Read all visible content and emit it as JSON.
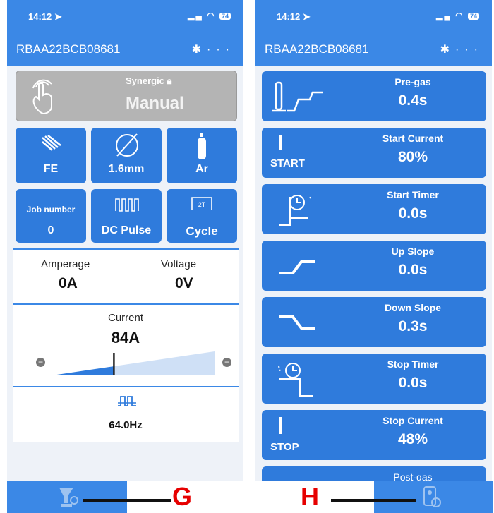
{
  "left": {
    "time": "14:12",
    "battery": "74",
    "device_id": "RBAA22BCB08681",
    "mode_top": "Synergic",
    "mode_main": "Manual",
    "material": "FE",
    "diameter": "1.6mm",
    "gas": "Ar",
    "job_label": "Job number",
    "job_value": "0",
    "process": "DC Pulse",
    "cycle_badge": "2T",
    "cycle": "Cycle",
    "amperage_label": "Amperage",
    "amperage_value": "0A",
    "voltage_label": "Voltage",
    "voltage_value": "0V",
    "current_label": "Current",
    "current_value": "84A",
    "current_fraction": 0.38,
    "frequency_value": "64.0Hz"
  },
  "right": {
    "time": "14:12",
    "battery": "74",
    "device_id": "RBAA22BCB08681",
    "params": [
      {
        "name": "Pre-gas",
        "value": "0.4s"
      },
      {
        "name": "Start Current",
        "value": "80%",
        "tag": "START"
      },
      {
        "name": "Start Timer",
        "value": "0.0s"
      },
      {
        "name": "Up Slope",
        "value": "0.0s"
      },
      {
        "name": "Down Slope",
        "value": "0.3s"
      },
      {
        "name": "Stop Timer",
        "value": "0.0s"
      },
      {
        "name": "Stop Current",
        "value": "48%",
        "tag": "STOP"
      },
      {
        "name": "Post-gas"
      }
    ]
  },
  "annotations": {
    "left_letter": "G",
    "right_letter": "H"
  },
  "colors": {
    "accent": "#3b88e6",
    "tile": "#2f7bdc",
    "annotation": "#e60000"
  }
}
